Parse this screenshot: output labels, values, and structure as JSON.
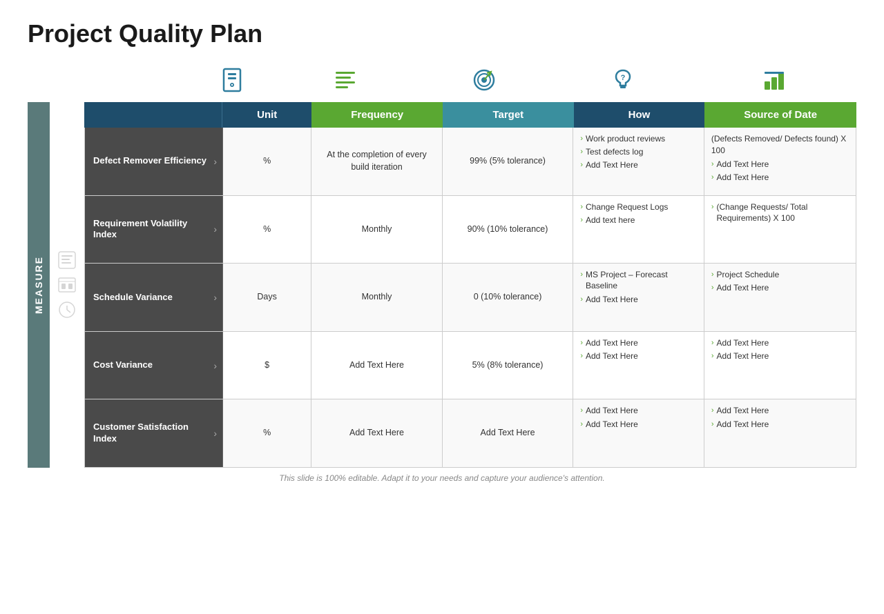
{
  "title": "Project Quality Plan",
  "icons": [
    {
      "name": "unit-icon",
      "symbol": "unit"
    },
    {
      "name": "frequency-icon",
      "symbol": "frequency"
    },
    {
      "name": "target-icon",
      "symbol": "target"
    },
    {
      "name": "how-icon",
      "symbol": "how"
    },
    {
      "name": "source-icon",
      "symbol": "source"
    }
  ],
  "headers": {
    "unit": "Unit",
    "frequency": "Frequency",
    "target": "Target",
    "how": "How",
    "source": "Source of Date"
  },
  "measure_label": "Measure",
  "rows": [
    {
      "metric": "Defect Remover Efficiency",
      "unit": "%",
      "frequency": "At the completion of every build iteration",
      "target": "99% (5% tolerance)",
      "how": [
        "Work product reviews",
        "Test defects log",
        "Add Text Here"
      ],
      "source": [
        "(Defects Removed/ Defects found) X 100",
        "Add Text Here",
        "Add Text Here"
      ]
    },
    {
      "metric": "Requirement Volatility Index",
      "unit": "%",
      "frequency": "Monthly",
      "target": "90% (10% tolerance)",
      "how": [
        "Change Request Logs",
        "Add text here"
      ],
      "source": [
        "(Change Requests/ Total Requirements) X 100"
      ]
    },
    {
      "metric": "Schedule Variance",
      "unit": "Days",
      "frequency": "Monthly",
      "target": "0 (10% tolerance)",
      "how": [
        "MS Project – Forecast Baseline",
        "Add Text Here"
      ],
      "source": [
        "Project Schedule",
        "Add Text Here"
      ]
    },
    {
      "metric": "Cost Variance",
      "unit": "$",
      "frequency": "Add Text Here",
      "target": "5% (8% tolerance)",
      "how": [
        "Add Text Here",
        "Add Text Here"
      ],
      "source": [
        "Add Text Here",
        "Add Text Here"
      ]
    },
    {
      "metric": "Customer Satisfaction Index",
      "unit": "%",
      "frequency": "Add Text Here",
      "target": "Add Text Here",
      "how": [
        "Add Text Here",
        "Add Text Here"
      ],
      "source": [
        "Add Text Here",
        "Add Text Here"
      ]
    }
  ],
  "footer": "This slide is 100% editable. Adapt it to your needs and capture your audience's attention."
}
